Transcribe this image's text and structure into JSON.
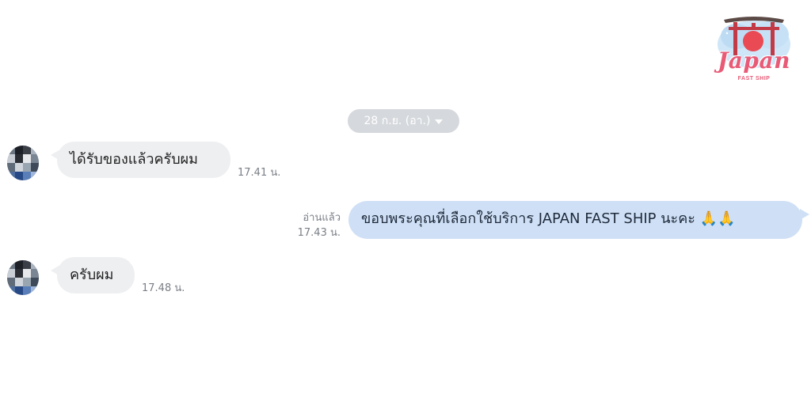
{
  "logo": {
    "wordmark": "Japan",
    "subtitle": "FAST SHIP",
    "colors": {
      "pink": "#e85a76",
      "red": "#e94a54",
      "sky": "#b9dcf6"
    }
  },
  "date_separator": {
    "label": "28 ก.ย. (อา.)",
    "icon": "caret-down-icon"
  },
  "messages": [
    {
      "direction": "incoming",
      "text": "ได้รับของแล้วครับผม",
      "time": "17.41 น."
    },
    {
      "direction": "outgoing",
      "read_status": "อ่านแล้ว",
      "time": "17.43 น.",
      "text": "ขอบพระคุณที่เลือกใช้บริการ JAPAN FAST SHIP นะคะ 🙏🙏"
    },
    {
      "direction": "incoming",
      "text": "ครับผม",
      "time": "17.48 น."
    }
  ],
  "colors": {
    "incoming_bubble": "#eeeff1",
    "outgoing_bubble": "#cfe0f6",
    "date_pill": "#d5d8dc",
    "meta_text": "#7a7f86"
  }
}
